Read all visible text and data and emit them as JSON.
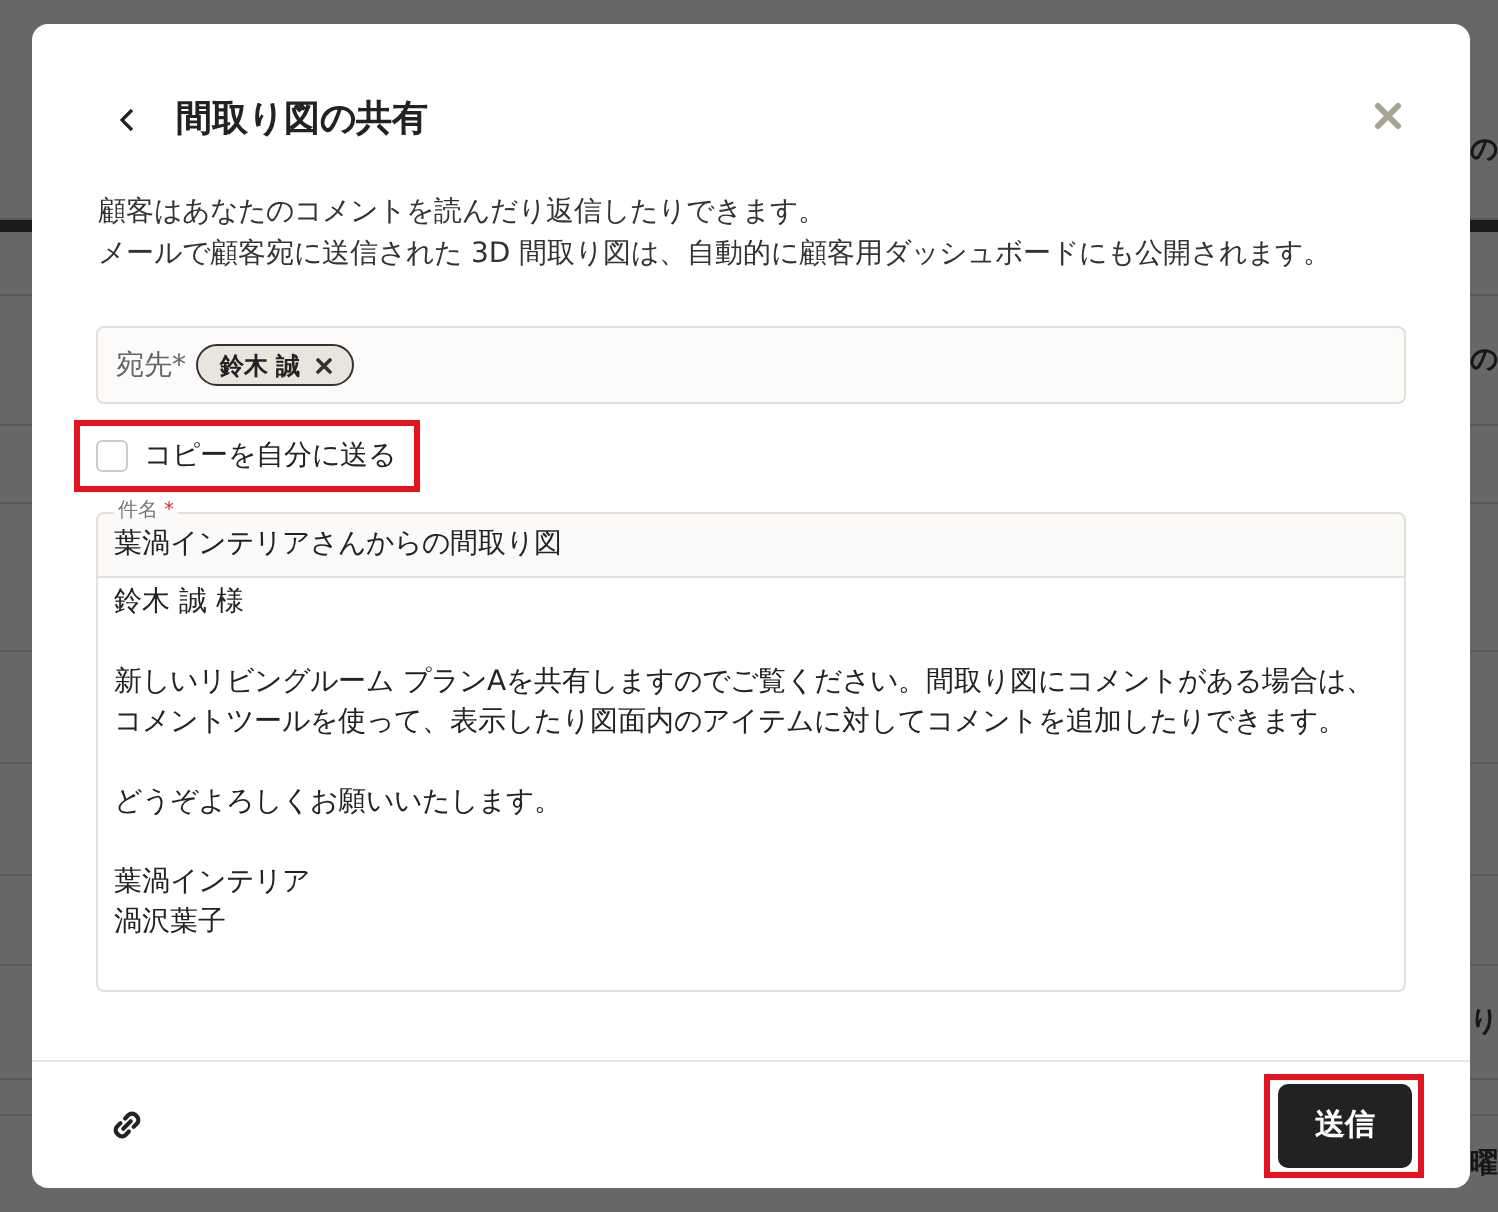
{
  "background": {
    "texts": [
      "の",
      "の",
      "り",
      "曜"
    ]
  },
  "dialog": {
    "title": "間取り図の共有",
    "description": [
      "顧客はあなたのコメントを読んだり返信したりできます。",
      "メールで顧客宛に送信された 3D 間取り図は、自動的に顧客用ダッシュボードにも公開されます。"
    ],
    "recipients": {
      "label": "宛先*",
      "chips": [
        {
          "name": "鈴木 誠"
        }
      ]
    },
    "copy_to_self": {
      "label": "コピーを自分に送る",
      "checked": false,
      "highlighted": true
    },
    "subject": {
      "label": "件名",
      "required_mark": "*",
      "value": "葉渦インテリアさんからの間取り図"
    },
    "message": {
      "paragraphs": [
        [
          "鈴木 誠 様"
        ],
        [
          "新しいリビングルーム プランAを共有しますのでご覧ください。間取り図にコメントがある場合は、",
          "コメントツールを使って、表示したり図面内のアイテムに対してコメントを追加したりできます。"
        ],
        [
          "どうぞよろしくお願いいたします。"
        ],
        [
          "葉渦インテリア",
          "渦沢葉子"
        ]
      ]
    },
    "send_button": {
      "label": "送信",
      "highlighted": true
    }
  }
}
